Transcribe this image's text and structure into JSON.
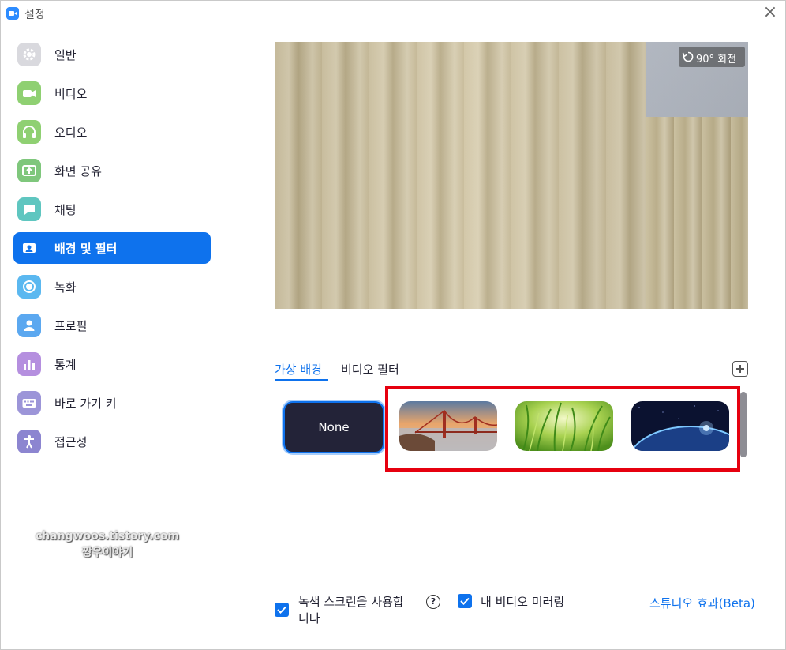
{
  "window": {
    "title": "설정"
  },
  "sidebar": {
    "items": [
      {
        "label": "일반",
        "icon": "gear-icon",
        "color": "#d9d9de"
      },
      {
        "label": "비디오",
        "icon": "video-camera-icon",
        "color": "#8fd072"
      },
      {
        "label": "오디오",
        "icon": "headphones-icon",
        "color": "#8fd072"
      },
      {
        "label": "화면 공유",
        "icon": "share-screen-icon",
        "color": "#7fc77c"
      },
      {
        "label": "채팅",
        "icon": "chat-bubble-icon",
        "color": "#5fc6c0"
      },
      {
        "label": "배경 및 필터",
        "icon": "person-card-icon",
        "color": "#ffffff",
        "active": true
      },
      {
        "label": "녹화",
        "icon": "record-icon",
        "color": "#5bb8f0"
      },
      {
        "label": "프로필",
        "icon": "user-icon",
        "color": "#5ba8f0"
      },
      {
        "label": "통계",
        "icon": "bar-chart-icon",
        "color": "#b58fdf"
      },
      {
        "label": "바로 가기 키",
        "icon": "keyboard-icon",
        "color": "#9c95d8"
      },
      {
        "label": "접근성",
        "icon": "accessibility-icon",
        "color": "#8c85d0"
      }
    ]
  },
  "watermark": {
    "line1": "changwoos.tistory.com",
    "line2": "짱우이야기"
  },
  "preview": {
    "rotate_label": "90° 회전"
  },
  "tabs": [
    {
      "label": "가상 배경",
      "active": true
    },
    {
      "label": "비디오 필터",
      "active": false
    }
  ],
  "backgrounds": {
    "none_label": "None",
    "items": [
      "golden-gate-bridge",
      "grass",
      "earth-from-space"
    ]
  },
  "footer": {
    "green_screen_label_line1": "녹색 스크린을 사용합",
    "green_screen_label_line2": "니다",
    "green_screen_checked": true,
    "mirror_label": "내 비디오 미러링",
    "mirror_checked": true,
    "studio_effects_label": "스튜디오 효과(Beta)"
  },
  "colors": {
    "accent": "#0e72ed",
    "highlight": "#e6000f"
  }
}
